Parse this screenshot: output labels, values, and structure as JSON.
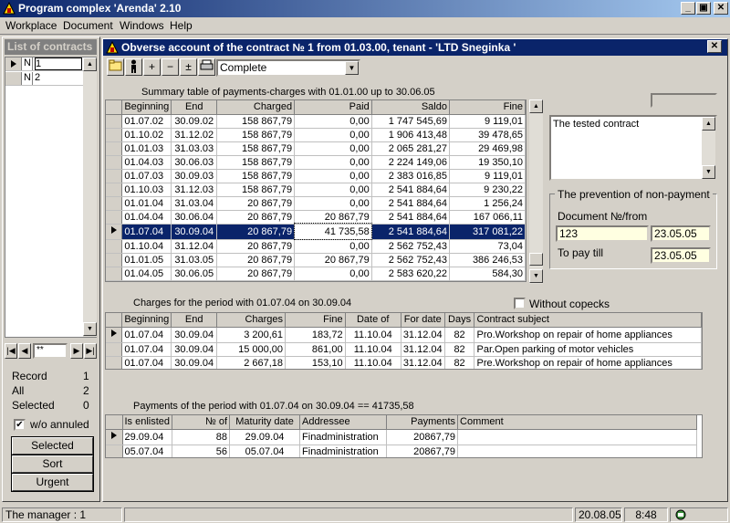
{
  "app": {
    "title": "Program complex 'Arenda' 2.10",
    "min": "_",
    "max": "▣",
    "close": "✕"
  },
  "menu": [
    "Workplace",
    "Document",
    "Windows",
    "Help"
  ],
  "left": {
    "title": "List of contracts",
    "rows": [
      {
        "n": "N",
        "v": "1"
      },
      {
        "n": "N",
        "v": "2"
      }
    ],
    "nav_value": "**",
    "record_label": "Record",
    "record": "1",
    "all_label": "All",
    "all": "2",
    "selected_label": "Selected",
    "selected": "0",
    "wo_annuled": "w/o annuled",
    "btn_selected": "Selected",
    "btn_sort": "Sort",
    "btn_urgent": "Urgent"
  },
  "child": {
    "title": "Obverse account of the contract № 1 from 01.03.00, tenant - 'LTD Sneginka '",
    "combo": "Complete",
    "summary_caption": "Summary table of payments-charges with 01.01.00 up to 30.06.05",
    "summary_headers": [
      "Beginning",
      "End",
      "Charged",
      "Paid",
      "Saldo",
      "Fine"
    ],
    "summary_rows": [
      [
        "01.07.02",
        "30.09.02",
        "158 867,79",
        "0,00",
        "1 747 545,69",
        "9 119,01"
      ],
      [
        "01.10.02",
        "31.12.02",
        "158 867,79",
        "0,00",
        "1 906 413,48",
        "39 478,65"
      ],
      [
        "01.01.03",
        "31.03.03",
        "158 867,79",
        "0,00",
        "2 065 281,27",
        "29 469,98"
      ],
      [
        "01.04.03",
        "30.06.03",
        "158 867,79",
        "0,00",
        "2 224 149,06",
        "19 350,10"
      ],
      [
        "01.07.03",
        "30.09.03",
        "158 867,79",
        "0,00",
        "2 383 016,85",
        "9 119,01"
      ],
      [
        "01.10.03",
        "31.12.03",
        "158 867,79",
        "0,00",
        "2 541 884,64",
        "9 230,22"
      ],
      [
        "01.01.04",
        "31.03.04",
        "20 867,79",
        "0,00",
        "2 541 884,64",
        "1 256,24"
      ],
      [
        "01.04.04",
        "30.06.04",
        "20 867,79",
        "20 867,79",
        "2 541 884,64",
        "167 066,11"
      ],
      [
        "01.07.04",
        "30.09.04",
        "20 867,79",
        "41 735,58",
        "2 541 884,64",
        "317 081,22"
      ],
      [
        "01.10.04",
        "31.12.04",
        "20 867,79",
        "0,00",
        "2 562 752,43",
        "73,04"
      ],
      [
        "01.01.05",
        "31.03.05",
        "20 867,79",
        "20 867,79",
        "2 562 752,43",
        "386 246,53"
      ],
      [
        "01.04.05",
        "30.06.05",
        "20 867,79",
        "0,00",
        "2 583 620,22",
        "584,30"
      ]
    ],
    "selected_row": 8,
    "charges_caption": "Charges for the period with 01.07.04 on 30.09.04",
    "without_copecks": "Without copecks",
    "charges_headers": [
      "Beginning",
      "End",
      "Charges",
      "Fine",
      "Date of",
      "For date",
      "Days",
      "Contract subject"
    ],
    "charges_rows": [
      [
        "01.07.04",
        "30.09.04",
        "3 200,61",
        "183,72",
        "11.10.04",
        "31.12.04",
        "82",
        "Pro.Workshop on repair of home appliances"
      ],
      [
        "01.07.04",
        "30.09.04",
        "15 000,00",
        "861,00",
        "11.10.04",
        "31.12.04",
        "82",
        "Par.Open parking of motor vehicles"
      ],
      [
        "01.07.04",
        "30.09.04",
        "2 667,18",
        "153,10",
        "11.10.04",
        "31.12.04",
        "82",
        "Pre.Workshop on repair of home appliances"
      ]
    ],
    "payments_caption": "Payments of the period with 01.07.04 on 30.09.04 == 41735,58",
    "payments_headers": [
      "Is enlisted",
      "№ of",
      "Maturity date",
      "Addressee",
      "Payments",
      "Comment"
    ],
    "payments_rows": [
      [
        "29.09.04",
        "88",
        "29.09.04",
        "Finadministration",
        "20867,79",
        ""
      ],
      [
        "05.07.04",
        "56",
        "05.07.04",
        "Finadministration",
        "20867,79",
        ""
      ]
    ],
    "memo": "The tested contract",
    "prevention_title": "The prevention of non-payment",
    "doc_label": "Document №/from",
    "doc_no": "123",
    "doc_date": "23.05.05",
    "paytill_label": "To pay till",
    "paytill_date": "23.05.05"
  },
  "status": {
    "manager": "The manager : 1",
    "date": "20.08.05",
    "time": "8:48"
  }
}
